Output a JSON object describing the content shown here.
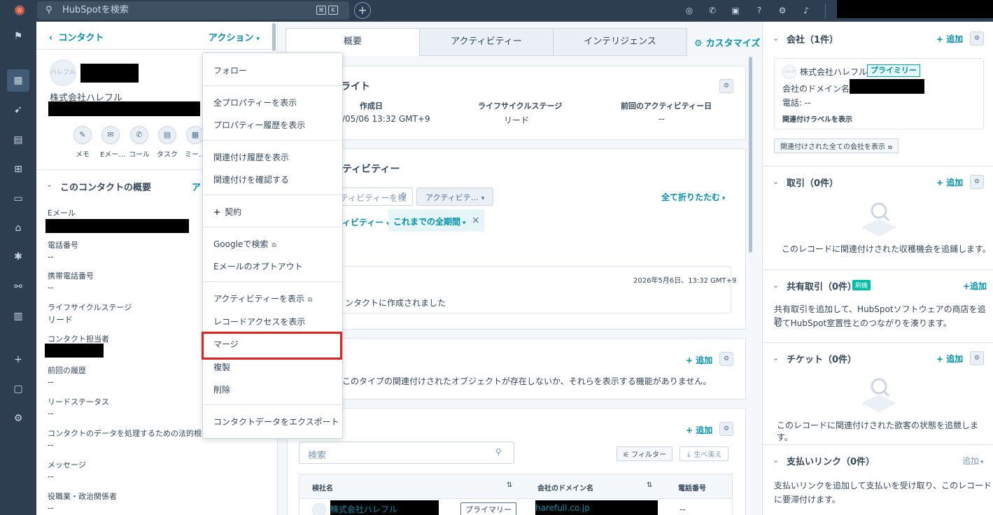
{
  "topbar": {
    "search_placeholder": "HubSpotを検索"
  },
  "left": {
    "back_label": "コンタクト",
    "actions_label": "アクション",
    "avatar_text": "ハレフル",
    "company_name": "株式会社ハレフル",
    "quick_actions": [
      "メモ",
      "Eメー…",
      "コール",
      "タスク",
      "ミー…"
    ],
    "about_title": "このコンタクトの概要",
    "about_more": "ア",
    "properties": [
      {
        "label": "Eメール",
        "value": ""
      },
      {
        "label": "電話番号",
        "value": "--"
      },
      {
        "label": "携帯電話番号",
        "value": "--"
      },
      {
        "label": "ライフサイクルステージ",
        "value": "リード"
      },
      {
        "label": "コンタクト担当者",
        "value": ""
      },
      {
        "label": "前回の履歴",
        "value": "--"
      },
      {
        "label": "リードステータス",
        "value": "--"
      },
      {
        "label": "コンタクトのデータを処理するための法的根拠",
        "value": "--"
      },
      {
        "label": "メッセージ",
        "value": "--"
      },
      {
        "label": "役職業・政治関係者",
        "value": "--"
      }
    ]
  },
  "menu": {
    "items": [
      "フォロー",
      "全プロパティーを表示",
      "プロパティー履歴を表示",
      "関連付け履歴を表示",
      "関連付けを確認する",
      "契約",
      "Googleで検索",
      "Eメールのオプトアウト",
      "アクティビティーを表示",
      "レコードアクセスを表示",
      "マージ",
      "複製",
      "削除",
      "コンタクトデータをエクスポート"
    ]
  },
  "center": {
    "tabs": [
      "概要",
      "アクティビティー",
      "インテリジェンス"
    ],
    "customize": "カスタマイズ",
    "highlights_title": "ライト",
    "highlights": [
      {
        "label": "作成日",
        "value": "/05/06 13:32 GMT+9"
      },
      {
        "label": "ライフサイクルステージ",
        "value": "リード"
      },
      {
        "label": "前回のアクティビティー日",
        "value": "--"
      }
    ],
    "activity_title": "ティビティー",
    "activity_search": "ティビティーを検",
    "activity_filter": "アクティビテ…",
    "collapse_all": "全て折りたたむ",
    "activity_type": "ィビティー",
    "time_filter": "これまでの全期間",
    "event_date": "2026年5月6日、13:32 GMT+9",
    "event_text": "ンタクトに作成されました",
    "add_label": "追加",
    "assoc_empty": "このタイプの関連付けされたオブジェクトが存在しないか、それらを表示する機能がありません。",
    "table_search": "検索",
    "filter_btn": "フィルター",
    "sort_btn": "生べ美え",
    "table_headers": [
      "検社名",
      "会社のドメイン名",
      "電話番号"
    ],
    "row": {
      "company": "株式会社ハレフル",
      "badge": "プライマリー",
      "domain": "harefull.co.jp",
      "phone": "--"
    }
  },
  "right": {
    "company": {
      "title": "会社（1件）",
      "add": "追加",
      "logo_text": "ハレフル",
      "name": "株式会社ハレフル",
      "badge": "プライミリー",
      "domain_label": "会社のドメイン名:",
      "phone_label": "電話: --",
      "assoc_label_link": "関連付けラベルを表示",
      "view_all": "関連付けされた全ての会社を表示"
    },
    "deals": {
      "title": "取引（0件）",
      "add": "追加",
      "empty": "このレコードに関連付けされた収穫機会を追鋪します。"
    },
    "shared_deals": {
      "title": "共有取引（0件）",
      "beta": "刷機",
      "add": "+追加",
      "text_1": "共有取引を追加して、HubSpotソフトウェアの商店を追跡",
      "text_2": "してHubSpot室置性とのつながりを湊ります。"
    },
    "tickets": {
      "title": "チケット（0件）",
      "add": "追加",
      "empty": "このレコードに関連付けされた欲客の状態を追競します。"
    },
    "payment_links": {
      "title": "支払いリンク（0件）",
      "add": "追加",
      "text_1": "支払いリンクを追加して支払いを受け取り、このレコード",
      "text_2": "に要滞付けます。"
    }
  }
}
